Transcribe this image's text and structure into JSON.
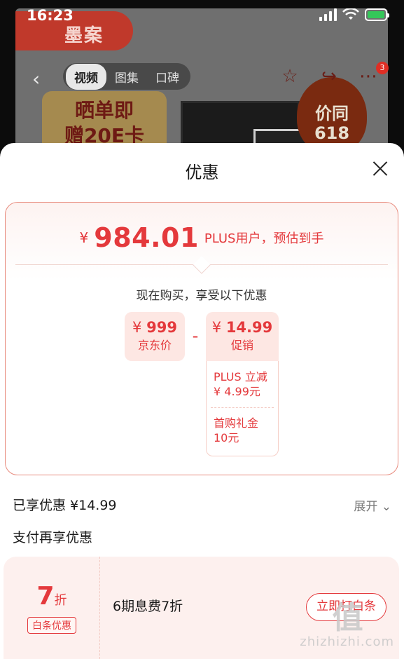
{
  "status_bar": {
    "time": "16:23"
  },
  "background_page": {
    "brand": "墨案",
    "tabs": [
      {
        "label": "视频",
        "active": true
      },
      {
        "label": "图集",
        "active": false
      },
      {
        "label": "口碑",
        "active": false
      }
    ],
    "notification_count": "3",
    "promo_tag": [
      "晒单即",
      "赠20E卡"
    ],
    "price_seal": [
      "价同",
      "618"
    ]
  },
  "sheet": {
    "title": "优惠",
    "final_price": {
      "currency": "¥",
      "value": "984.01",
      "note": "PLUS用户，预估到手"
    },
    "now_buy_text": "现在购买，享受以下优惠",
    "calc": {
      "base": {
        "currency": "¥",
        "value": "999",
        "label": "京东价"
      },
      "operator": "-",
      "promo": {
        "currency": "¥",
        "value": "14.99",
        "label": "促销"
      },
      "details": [
        {
          "line1": "PLUS 立减",
          "line2": "¥ 4.99元"
        },
        {
          "line1": "首购礼金",
          "line2": "10元"
        }
      ]
    },
    "enjoyed": "已享优惠 ¥14.99",
    "expand_label": "展开",
    "pay_section_title": "支付再享优惠",
    "pay_offer": {
      "discount_value": "7",
      "discount_unit": "折",
      "tag": "白条优惠",
      "description": "6期息费7折",
      "button": "立即打白条"
    }
  },
  "watermark": {
    "logo": "值",
    "url": "zhizhizhi.com"
  },
  "colors": {
    "accent": "#e4393c",
    "battery": "#34c759"
  }
}
